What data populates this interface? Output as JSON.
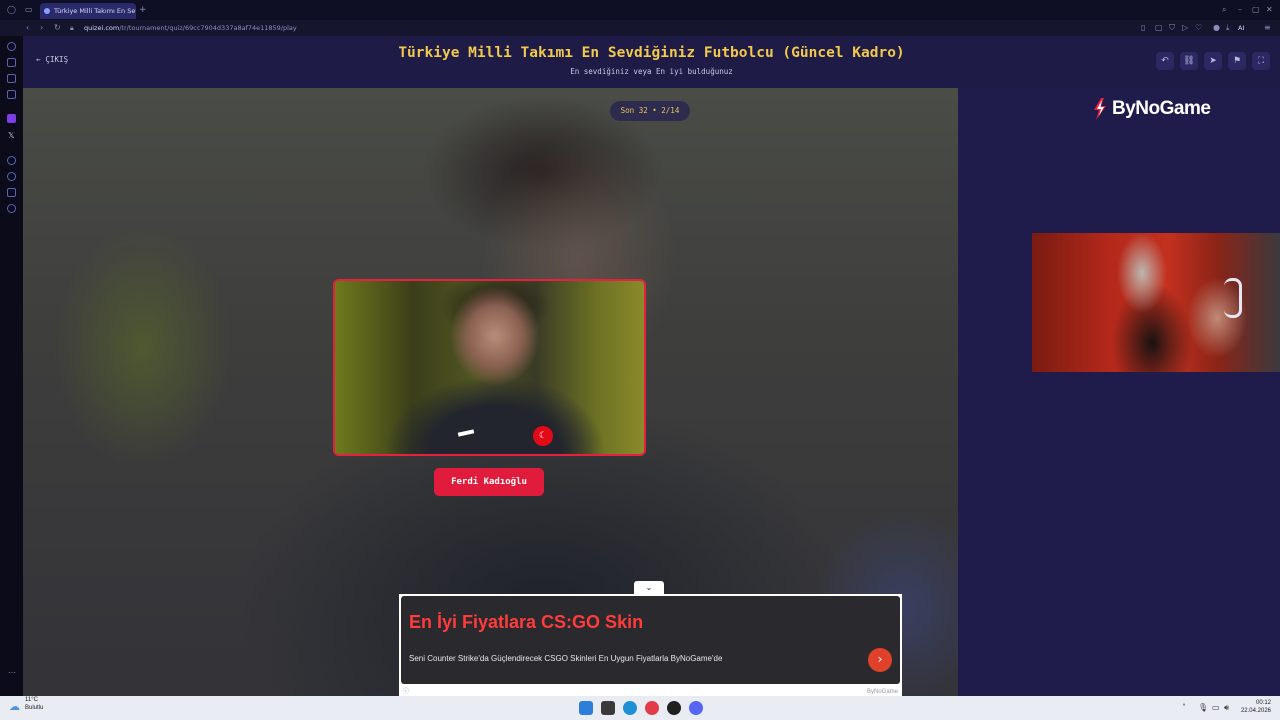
{
  "browser": {
    "tab_title": "Türkiye Milli Takımı En Sev...",
    "new_tab": "+",
    "url_domain": "quizei.com",
    "url_path": "/tr/tournament/quiz/69cc7904d337a8af74e11859/play",
    "ai_label": "AI"
  },
  "header": {
    "back_label": "ÇIKIŞ",
    "title": "Türkiye Milli Takımı En Sevdiğiniz Futbolcu (Güncel Kadro)",
    "subtitle": "En sevdiğiniz veya En iyi bulduğunuz",
    "action_icons": [
      "undo-icon",
      "share-link-icon",
      "send-icon",
      "flag-icon",
      "fullscreen-icon"
    ]
  },
  "tournament": {
    "round_badge": "Son 32 • 2/14",
    "player_name": "Ferdi Kadıoğlu"
  },
  "brand": {
    "name": "ByNoGame"
  },
  "ad": {
    "toggle_icon": "chevron-down-icon",
    "title": "En İyi Fiyatlara CS:GO Skin",
    "description": "Seni Counter Strike'da Güçlendirecek CSGO Skinleri En Uygun Fiyatlarla ByNoGame'de",
    "footer": "ByNoGame"
  },
  "taskbar": {
    "weather_temp": "11°C",
    "weather_desc": "Bulutlu",
    "time": "00:12",
    "date": "22.04.2026"
  },
  "colors": {
    "accent_red": "#e01b3c",
    "title_yellow": "#f2c94c",
    "header_bg": "#1e1b47"
  }
}
